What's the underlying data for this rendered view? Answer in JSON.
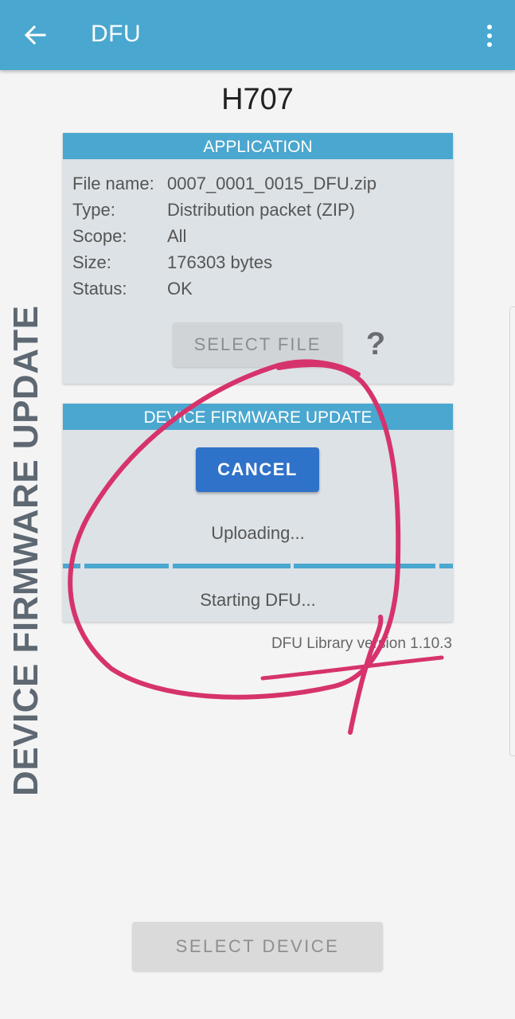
{
  "app_bar": {
    "title": "DFU",
    "back_icon": "arrow-left-icon",
    "menu_icon": "more-vertical-icon",
    "color": "#4aa7cf"
  },
  "device": {
    "name": "H707"
  },
  "side_label": "DEVICE FIRMWARE UPDATE",
  "application": {
    "header": "APPLICATION",
    "rows": [
      {
        "label": "File name:",
        "value": "0007_0001_0015_DFU.zip"
      },
      {
        "label": "Type:",
        "value": "Distribution packet (ZIP)"
      },
      {
        "label": "Scope:",
        "value": "All"
      },
      {
        "label": "Size:",
        "value": "176303 bytes"
      },
      {
        "label": "Status:",
        "value": "OK"
      }
    ],
    "select_file_label": "SELECT FILE",
    "help_label": "?"
  },
  "dfu": {
    "header": "DEVICE FIRMWARE UPDATE",
    "cancel_label": "CANCEL",
    "upload_status": "Uploading...",
    "dfu_status": "Starting DFU...",
    "cancel_color": "#2f72c9"
  },
  "version_text": "DFU Library version 1.10.3",
  "select_device_label": "SELECT DEVICE",
  "annotation_color": "#d6336c"
}
